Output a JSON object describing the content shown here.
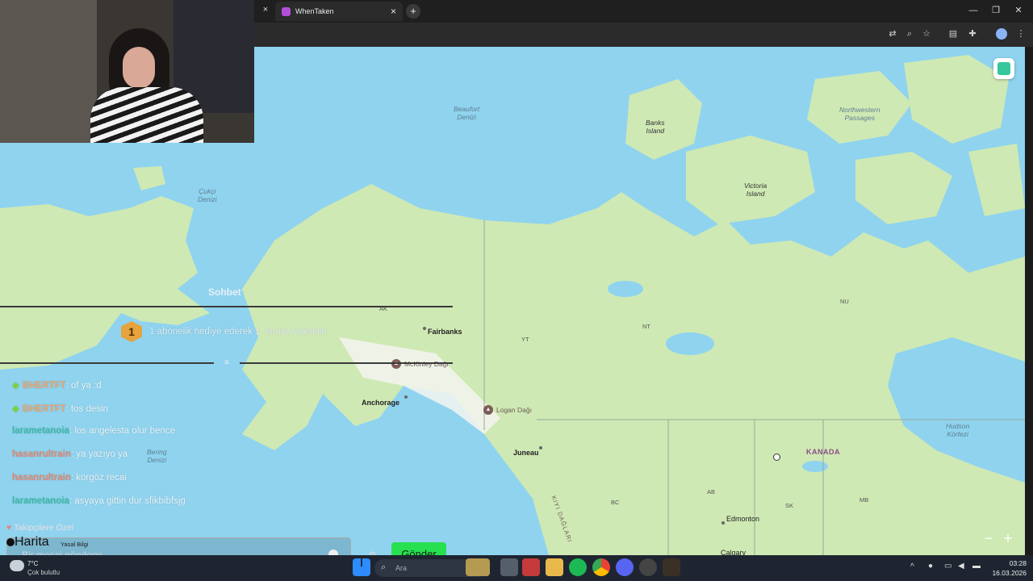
{
  "browser": {
    "tabs": [
      {
        "label": "WhenTaken",
        "active": true
      }
    ],
    "new_tab": "+",
    "tab_close": "×"
  },
  "map": {
    "seas": {
      "beaufort": "Beaufort\nDenizi",
      "chukchi": "Çukçi\nDenizi",
      "bering": "Bering\nDenizi",
      "hudson": "Hudson\nKörfezi",
      "nw_passages": "Northwestern\nPassages"
    },
    "islands": {
      "banks": "Banks\nIsland",
      "victoria": "Victoria\nIsland"
    },
    "regions": {
      "ak": "AK",
      "yt": "YT",
      "nt": "NT",
      "nu": "NU",
      "bc": "BC",
      "ab": "AB",
      "sk": "SK",
      "mb": "MB"
    },
    "country": "KANADA",
    "cities": {
      "fairbanks": "Fairbanks",
      "anchorage": "Anchorage",
      "juneau": "Juneau",
      "edmonton": "Edmonton",
      "calgary": "Calgary"
    },
    "peaks": {
      "mckinley": "McKinley Dağı",
      "logan": "Logan Dağı"
    },
    "range": "KIYI DAĞLARI",
    "zoom_out": "−",
    "zoom_in": "+",
    "map_button": "Harita"
  },
  "chat": {
    "title": "Sohbet",
    "pinned_badge": "1",
    "pinned_text": "1 abonelik hediye ederek 1. sıraya yükselin",
    "messages": [
      {
        "user": "BHERTFT",
        "text": ": of ya :d",
        "color": "orange",
        "badge": true
      },
      {
        "user": "BHERTFT",
        "text": ": tos desin",
        "color": "orange",
        "badge": true
      },
      {
        "user": "larametanoia",
        "text": ": los angelesta olur bence",
        "color": "teal",
        "badge": false
      },
      {
        "user": "hasanrultrain",
        "text": ": ya yazıyo ya",
        "color": "red",
        "badge": false
      },
      {
        "user": "hasanrultrain",
        "text": ": korgöz recai",
        "color": "red",
        "badge": false
      },
      {
        "user": "larametanoia",
        "text": ": asyaya gittin dur sfikbibfsjg",
        "color": "teal",
        "badge": false
      }
    ],
    "followers_only": "Takipçilere Özel",
    "input_placeholder": "Bir mesaj gönderin",
    "send_button": "Gönder",
    "legal": "Yasal Bilgi"
  },
  "taskbar": {
    "weather_temp": "7°C",
    "weather_desc": "Çok bulutlu",
    "search_placeholder": "Ara",
    "time": "03:28",
    "date": "16.03.2026"
  }
}
